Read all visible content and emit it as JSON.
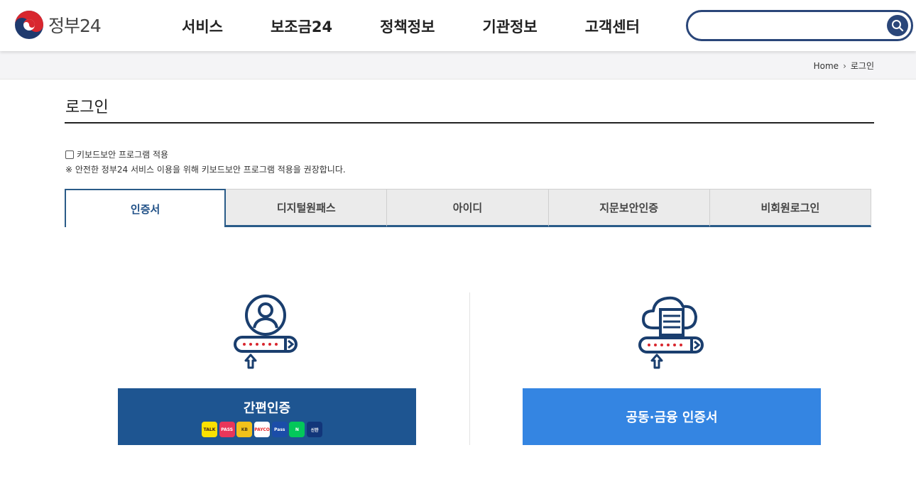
{
  "header": {
    "logo_text": "정부24",
    "nav": [
      "서비스",
      "보조금24",
      "정책정보",
      "기관정보",
      "고객센터"
    ],
    "search": {
      "value": "",
      "placeholder": ""
    }
  },
  "breadcrumb": {
    "home": "Home",
    "current": "로그인"
  },
  "page": {
    "title": "로그인",
    "keyboard_security_label": "키보드보안 프로그램 적용",
    "keyboard_security_checked": false,
    "keyboard_note": "※ 안전한 정부24 서비스 이용을 위해 키보드보안 프로그램 적용을 권장합니다."
  },
  "tabs": [
    {
      "label": "인증서",
      "active": true
    },
    {
      "label": "디지털원패스",
      "active": false
    },
    {
      "label": "아이디",
      "active": false
    },
    {
      "label": "지문보안인증",
      "active": false
    },
    {
      "label": "비회원로그인",
      "active": false
    }
  ],
  "login_options": {
    "easy_auth": {
      "label": "간편인증",
      "providers": [
        {
          "name": "kakao-icon",
          "text": "TALK",
          "bg": "#fae100",
          "fg": "#3b1e1e"
        },
        {
          "name": "pass-icon",
          "text": "PASS",
          "bg": "#e8365a",
          "fg": "#ffffff"
        },
        {
          "name": "kb-icon",
          "text": "KB",
          "bg": "#f2c21b",
          "fg": "#4a3b16"
        },
        {
          "name": "payco-icon",
          "text": "PAYCO",
          "bg": "#ffffff",
          "fg": "#e8262a"
        },
        {
          "name": "samsung-pass-icon",
          "text": "Pass",
          "bg": "#1b4da8",
          "fg": "#ffffff"
        },
        {
          "name": "naver-icon",
          "text": "N",
          "bg": "#03c75a",
          "fg": "#ffffff"
        },
        {
          "name": "shinhan-icon",
          "text": "신한",
          "bg": "#12367a",
          "fg": "#ffffff"
        }
      ]
    },
    "certificate": {
      "label": "공동·금융 인증서"
    }
  },
  "colors": {
    "navy": "#2a4679",
    "tab_accent": "#2a5b88",
    "easy_button": "#1e5591",
    "cert_button": "#3485e2"
  }
}
